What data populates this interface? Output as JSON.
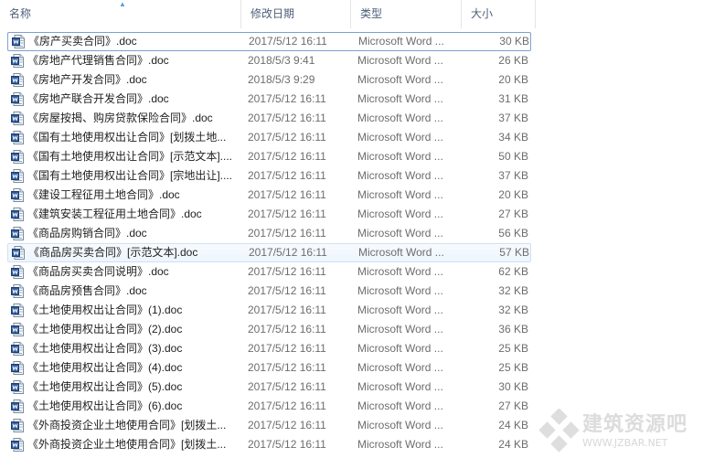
{
  "columns": {
    "name": "名称",
    "date": "修改日期",
    "type": "类型",
    "size": "大小"
  },
  "files": [
    {
      "name": "《房产买卖合同》.doc",
      "date": "2017/5/12 16:11",
      "type": "Microsoft Word ...",
      "size": "30 KB"
    },
    {
      "name": "《房地产代理销售合同》.doc",
      "date": "2018/5/3 9:41",
      "type": "Microsoft Word ...",
      "size": "26 KB"
    },
    {
      "name": "《房地产开发合同》.doc",
      "date": "2018/5/3 9:29",
      "type": "Microsoft Word ...",
      "size": "20 KB"
    },
    {
      "name": "《房地产联合开发合同》.doc",
      "date": "2017/5/12 16:11",
      "type": "Microsoft Word ...",
      "size": "31 KB"
    },
    {
      "name": "《房屋按揭、购房贷款保险合同》.doc",
      "date": "2017/5/12 16:11",
      "type": "Microsoft Word ...",
      "size": "37 KB"
    },
    {
      "name": "《国有土地使用权出让合同》[划拨土地...",
      "date": "2017/5/12 16:11",
      "type": "Microsoft Word ...",
      "size": "34 KB"
    },
    {
      "name": "《国有土地使用权出让合同》[示范文本]....",
      "date": "2017/5/12 16:11",
      "type": "Microsoft Word ...",
      "size": "50 KB"
    },
    {
      "name": "《国有土地使用权出让合同》[宗地出让]....",
      "date": "2017/5/12 16:11",
      "type": "Microsoft Word ...",
      "size": "37 KB"
    },
    {
      "name": "《建设工程征用土地合同》.doc",
      "date": "2017/5/12 16:11",
      "type": "Microsoft Word ...",
      "size": "20 KB"
    },
    {
      "name": "《建筑安装工程征用土地合同》.doc",
      "date": "2017/5/12 16:11",
      "type": "Microsoft Word ...",
      "size": "27 KB"
    },
    {
      "name": "《商品房购销合同》.doc",
      "date": "2017/5/12 16:11",
      "type": "Microsoft Word ...",
      "size": "56 KB"
    },
    {
      "name": "《商品房买卖合同》[示范文本].doc",
      "date": "2017/5/12 16:11",
      "type": "Microsoft Word ...",
      "size": "57 KB"
    },
    {
      "name": "《商品房买卖合同说明》.doc",
      "date": "2017/5/12 16:11",
      "type": "Microsoft Word ...",
      "size": "62 KB"
    },
    {
      "name": "《商品房预售合同》.doc",
      "date": "2017/5/12 16:11",
      "type": "Microsoft Word ...",
      "size": "32 KB"
    },
    {
      "name": "《土地使用权出让合同》(1).doc",
      "date": "2017/5/12 16:11",
      "type": "Microsoft Word ...",
      "size": "32 KB"
    },
    {
      "name": "《土地使用权出让合同》(2).doc",
      "date": "2017/5/12 16:11",
      "type": "Microsoft Word ...",
      "size": "36 KB"
    },
    {
      "name": "《土地使用权出让合同》(3).doc",
      "date": "2017/5/12 16:11",
      "type": "Microsoft Word ...",
      "size": "25 KB"
    },
    {
      "name": "《土地使用权出让合同》(4).doc",
      "date": "2017/5/12 16:11",
      "type": "Microsoft Word ...",
      "size": "25 KB"
    },
    {
      "name": "《土地使用权出让合同》(5).doc",
      "date": "2017/5/12 16:11",
      "type": "Microsoft Word ...",
      "size": "30 KB"
    },
    {
      "name": "《土地使用权出让合同》(6).doc",
      "date": "2017/5/12 16:11",
      "type": "Microsoft Word ...",
      "size": "27 KB"
    },
    {
      "name": "《外商投资企业土地使用合同》[划拨土...",
      "date": "2017/5/12 16:11",
      "type": "Microsoft Word ...",
      "size": "24 KB"
    },
    {
      "name": "《外商投资企业土地使用合同》[划拨土...",
      "date": "2017/5/12 16:11",
      "type": "Microsoft Word ...",
      "size": "24 KB"
    }
  ],
  "focused_index": 0,
  "hovered_index": 11,
  "icon": "word-document-icon",
  "watermark": {
    "text": "建筑资源吧",
    "url": "WWW.JZBAR.NET"
  },
  "colors": {
    "header_text": "#4c607a",
    "focus_border": "#7da2ce",
    "hover_border": "#cfe1f5",
    "sort_arrow": "#569de5"
  }
}
